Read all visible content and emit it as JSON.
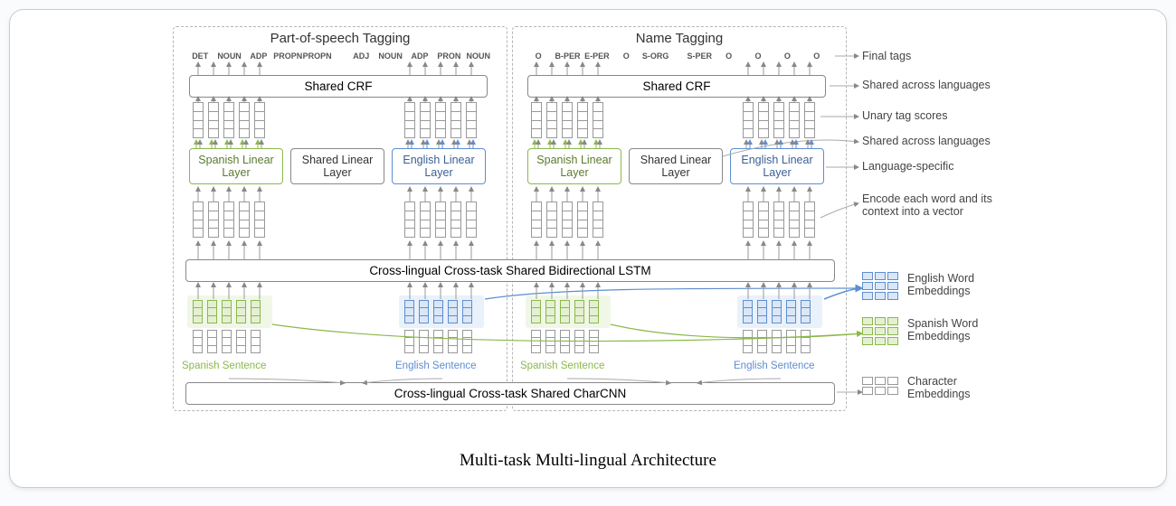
{
  "caption": "Multi-task Multi-lingual Architecture",
  "tasks": {
    "pos": {
      "title": "Part-of-speech Tagging"
    },
    "ner": {
      "title": "Name Tagging"
    }
  },
  "layers": {
    "crf": "Shared CRF",
    "linear_spanish": "Spanish Linear Layer",
    "linear_shared": "Shared Linear Layer",
    "linear_english": "English Linear Layer",
    "lstm": "Cross-lingual Cross-task Shared Bidirectional LSTM",
    "charcnn": "Cross-lingual Cross-task Shared CharCNN"
  },
  "tags": {
    "pos_sp": [
      "DET",
      "NOUN",
      "ADP",
      "PROPN",
      "PROPN"
    ],
    "pos_en": [
      "ADJ",
      "NOUN",
      "ADP",
      "PRON",
      "NOUN"
    ],
    "ner_sp": [
      "O",
      "B-PER",
      "E-PER",
      "O",
      "S-ORG"
    ],
    "ner_en": [
      "S-PER",
      "O",
      "O",
      "O",
      "O"
    ]
  },
  "sentence_labels": {
    "spanish": "Spanish Sentence",
    "english": "English Sentence"
  },
  "side_labels": {
    "final_tags": "Final tags",
    "shared_lang_1": "Shared across languages",
    "unary": "Unary tag scores",
    "shared_lang_2": "Shared across languages",
    "lang_specific": "Language-specific",
    "encode": "Encode each word and its context into a vector",
    "eng_embed": "English Word Embeddings",
    "spa_embed": "Spanish Word Embeddings",
    "char_embed": "Character Embeddings"
  }
}
